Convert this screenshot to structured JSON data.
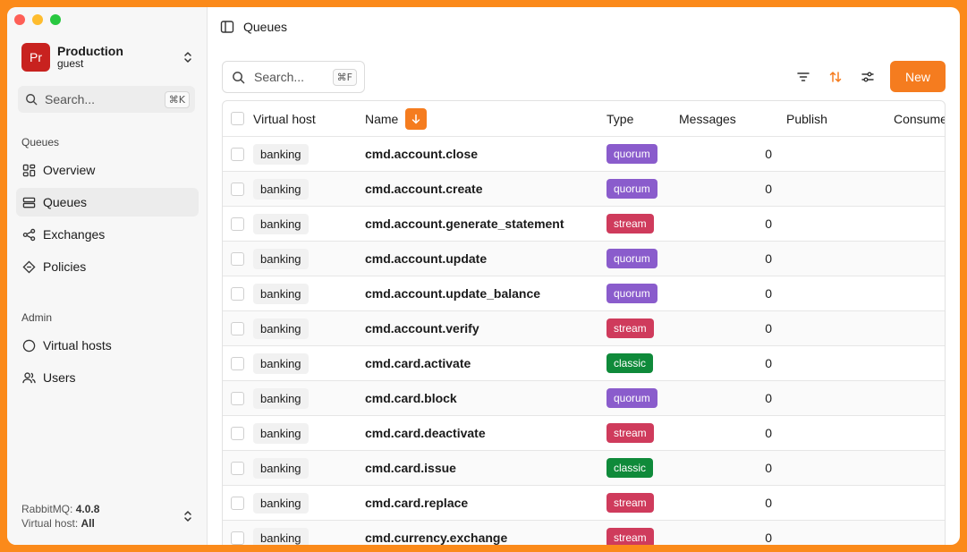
{
  "window": {
    "traffic_lights": [
      "close",
      "minimize",
      "zoom"
    ]
  },
  "sidebar": {
    "account": {
      "initials": "Pr",
      "name": "Production",
      "user": "guest",
      "avatar_color": "#c8221f"
    },
    "search": {
      "placeholder": "Search...",
      "shortcut": "⌘K"
    },
    "sections": [
      {
        "label": "Queues",
        "items": [
          {
            "label": "Overview",
            "icon": "overview-grid-icon",
            "active": false
          },
          {
            "label": "Queues",
            "icon": "queues-stack-icon",
            "active": true
          },
          {
            "label": "Exchanges",
            "icon": "exchanges-share-icon",
            "active": false
          },
          {
            "label": "Policies",
            "icon": "policies-diamond-icon",
            "active": false
          }
        ]
      },
      {
        "label": "Admin",
        "items": [
          {
            "label": "Virtual hosts",
            "icon": "virtual-hosts-circle-icon",
            "active": false
          },
          {
            "label": "Users",
            "icon": "users-icon",
            "active": false
          }
        ]
      }
    ],
    "footer": {
      "version_label": "RabbitMQ:",
      "version": "4.0.8",
      "vhost_label": "Virtual host:",
      "vhost": "All"
    }
  },
  "header": {
    "title": "Queues",
    "toggle_icon": "sidebar-toggle-icon"
  },
  "toolbar": {
    "search": {
      "placeholder": "Search...",
      "shortcut": "⌘F"
    },
    "filter_icon": "filter-icon",
    "sort_icon": "sort-arrows-icon",
    "settings_icon": "settings-sliders-icon",
    "new_label": "New",
    "accent": "#f57c1f"
  },
  "table": {
    "columns": [
      "Virtual host",
      "Name",
      "Type",
      "Messages",
      "Publish",
      "Consumers"
    ],
    "type_colors": {
      "quorum": "#8a5ccc",
      "stream": "#cf3b5c",
      "classic": "#0f8a3a"
    },
    "rows": [
      {
        "vhost": "banking",
        "name": "cmd.account.close",
        "type": "quorum",
        "messages": "0"
      },
      {
        "vhost": "banking",
        "name": "cmd.account.create",
        "type": "quorum",
        "messages": "0"
      },
      {
        "vhost": "banking",
        "name": "cmd.account.generate_statement",
        "type": "stream",
        "messages": "0"
      },
      {
        "vhost": "banking",
        "name": "cmd.account.update",
        "type": "quorum",
        "messages": "0"
      },
      {
        "vhost": "banking",
        "name": "cmd.account.update_balance",
        "type": "quorum",
        "messages": "0"
      },
      {
        "vhost": "banking",
        "name": "cmd.account.verify",
        "type": "stream",
        "messages": "0"
      },
      {
        "vhost": "banking",
        "name": "cmd.card.activate",
        "type": "classic",
        "messages": "0"
      },
      {
        "vhost": "banking",
        "name": "cmd.card.block",
        "type": "quorum",
        "messages": "0"
      },
      {
        "vhost": "banking",
        "name": "cmd.card.deactivate",
        "type": "stream",
        "messages": "0"
      },
      {
        "vhost": "banking",
        "name": "cmd.card.issue",
        "type": "classic",
        "messages": "0"
      },
      {
        "vhost": "banking",
        "name": "cmd.card.replace",
        "type": "stream",
        "messages": "0"
      },
      {
        "vhost": "banking",
        "name": "cmd.currency.exchange",
        "type": "stream",
        "messages": "0"
      }
    ]
  }
}
